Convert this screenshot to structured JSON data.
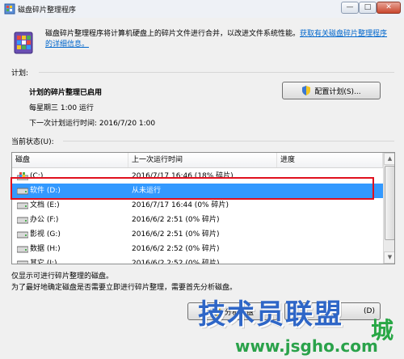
{
  "window": {
    "title": "磁盘碎片整理程序",
    "minimize": "—",
    "maximize": "□",
    "close": "✕"
  },
  "header": {
    "description": "磁盘碎片整理程序将计算机硬盘上的碎片文件进行合并，以改进文件系统性能。",
    "link": "获取有关磁盘碎片整理程序的详细信息。"
  },
  "schedule": {
    "section_label": "计划:",
    "status": "计划的碎片整理已启用",
    "run_time": "每星期三  1:00 运行",
    "next_run": "下一次计划运行时间: 2016/7/20 1:00",
    "configure_button": "配置计划(S)..."
  },
  "current_status": {
    "section_label": "当前状态(U):",
    "columns": [
      "磁盘",
      "上一次运行时间",
      "进度"
    ],
    "rows": [
      {
        "disk": "(C:)",
        "last_run": "2016/7/17 16:46 (18% 碎片)",
        "progress": "",
        "icon": "windows-drive-icon"
      },
      {
        "disk": "软件 (D:)",
        "last_run": "从未运行",
        "progress": "",
        "icon": "hard-drive-icon"
      },
      {
        "disk": "文档 (E:)",
        "last_run": "2016/7/17 16:44 (0% 碎片)",
        "progress": "",
        "icon": "hard-drive-icon"
      },
      {
        "disk": "办公 (F:)",
        "last_run": "2016/6/2 2:51 (0% 碎片)",
        "progress": "",
        "icon": "hard-drive-icon"
      },
      {
        "disk": "影视 (G:)",
        "last_run": "2016/6/2 2:51 (0% 碎片)",
        "progress": "",
        "icon": "hard-drive-icon"
      },
      {
        "disk": "数据 (H:)",
        "last_run": "2016/6/2 2:52 (0% 碎片)",
        "progress": "",
        "icon": "hard-drive-icon"
      },
      {
        "disk": "其它 (I:)",
        "last_run": "2016/6/2 2:52 (0% 碎片)",
        "progress": "",
        "icon": "hard-drive-icon"
      }
    ],
    "selected_index": 1
  },
  "notes": {
    "line1": "仅显示可进行碎片整理的磁盘。",
    "line2": "为了最好地确定磁盘是否需要立即进行碎片整理，需要首先分析磁盘。"
  },
  "actions": {
    "analyze_button": "分析磁盘",
    "defrag_button": "(D)"
  },
  "watermark": {
    "title": "技术员联盟",
    "suffix": "城",
    "url": "www.jsgho.com"
  },
  "colors": {
    "selection": "#3399ff",
    "highlight_box": "#e0101e",
    "link": "#0066cc",
    "watermark_blue": "#2e66c7",
    "watermark_green": "#2aa24a"
  }
}
